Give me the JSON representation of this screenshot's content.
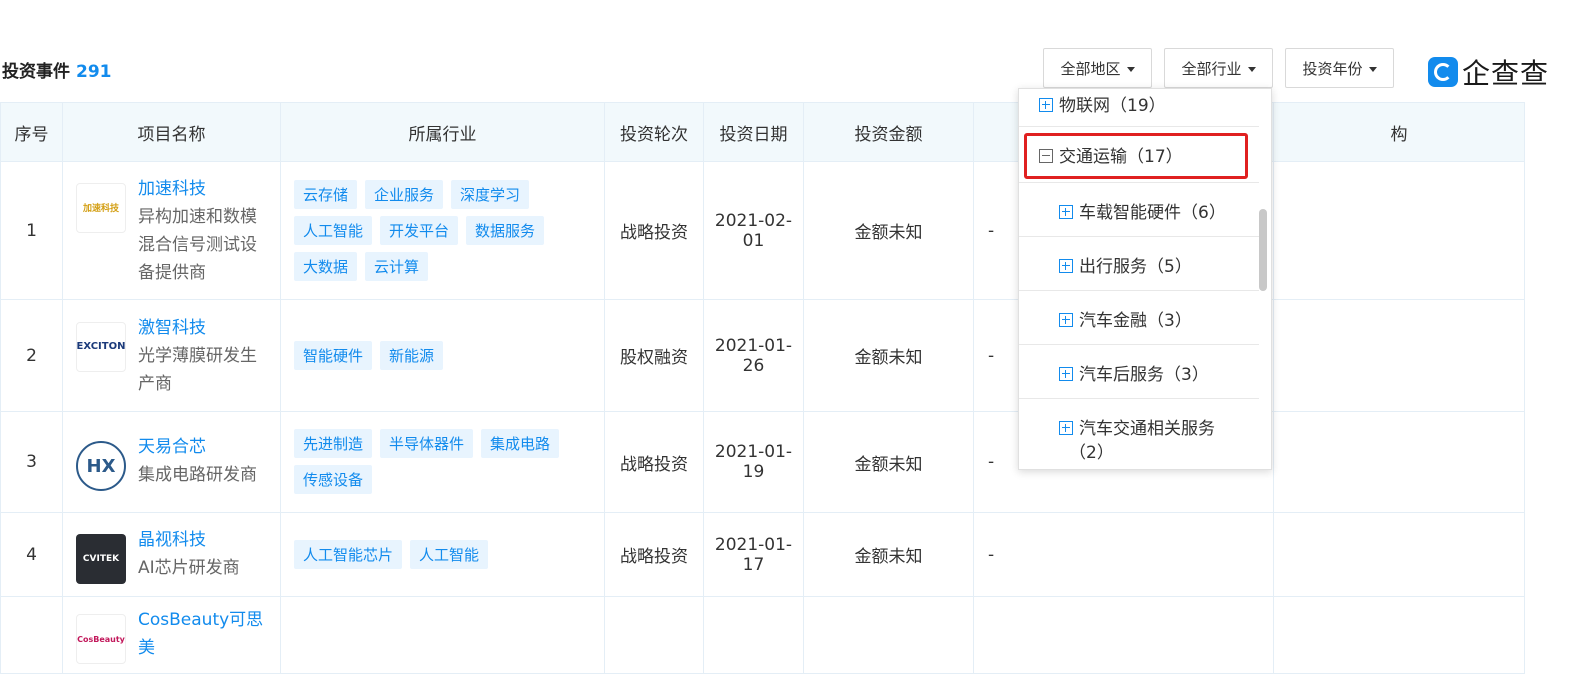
{
  "header": {
    "title": "投资事件",
    "count": "291"
  },
  "filters": {
    "region": "全部地区",
    "industry": "全部行业",
    "year": "投资年份"
  },
  "brand": {
    "name": "企查查",
    "color": "#128bed"
  },
  "table": {
    "columns": [
      "序号",
      "项目名称",
      "所属行业",
      "投资轮次",
      "投资日期",
      "投资金额",
      "",
      "构"
    ],
    "rows": [
      {
        "index": "1",
        "name": "加速科技",
        "desc": "异构加速和数模混合信号测试设备提供商",
        "logo_text": "加速科技",
        "tags": [
          "云存储",
          "企业服务",
          "深度学习",
          "人工智能",
          "开发平台",
          "数据服务",
          "大数据",
          "云计算"
        ],
        "round": "战略投资",
        "date": "2021-02-01",
        "amount": "金额未知",
        "extra": "-"
      },
      {
        "index": "2",
        "name": "激智科技",
        "desc": "光学薄膜研发生产商",
        "logo_text": "EXCITON",
        "tags": [
          "智能硬件",
          "新能源"
        ],
        "round": "股权融资",
        "date": "2021-01-26",
        "amount": "金额未知",
        "extra": "-"
      },
      {
        "index": "3",
        "name": "天易合芯",
        "desc": "集成电路研发商",
        "logo_text": "HX",
        "tags": [
          "先进制造",
          "半导体器件",
          "集成电路",
          "传感设备"
        ],
        "round": "战略投资",
        "date": "2021-01-19",
        "amount": "金额未知",
        "extra": "-"
      },
      {
        "index": "4",
        "name": "晶视科技",
        "desc": "AI芯片研发商",
        "logo_text": "CVITEK",
        "tags": [
          "人工智能芯片",
          "人工智能"
        ],
        "round": "战略投资",
        "date": "2021-01-17",
        "amount": "金额未知",
        "extra": "-"
      },
      {
        "index": "",
        "name": "CosBeauty可思美",
        "desc": "",
        "logo_text": "CosBeauty",
        "tags": [],
        "round": "",
        "date": "",
        "amount": "",
        "extra": ""
      }
    ]
  },
  "industry_dropdown": {
    "items": [
      {
        "label": "物联网（19）",
        "state": "plus",
        "level": 0
      },
      {
        "label": "交通运输（17）",
        "state": "minus",
        "level": 0,
        "highlighted": true
      },
      {
        "label": "车载智能硬件（6）",
        "state": "plus",
        "level": 1
      },
      {
        "label": "出行服务（5）",
        "state": "plus",
        "level": 1
      },
      {
        "label": "汽车金融（3）",
        "state": "plus",
        "level": 1
      },
      {
        "label": "汽车后服务（3）",
        "state": "plus",
        "level": 1
      },
      {
        "label": "汽车交通相关服务",
        "label_cont": "（2）",
        "state": "plus",
        "level": 1
      }
    ]
  }
}
